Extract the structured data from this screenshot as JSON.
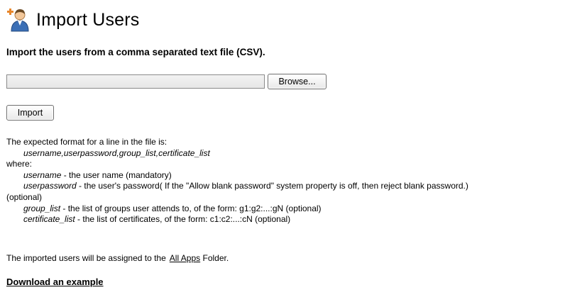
{
  "header": {
    "title": "Import Users",
    "icon": "add-user-icon",
    "subtitle": "Import the users from a comma separated text file (CSV)."
  },
  "file_picker": {
    "value": "",
    "browse_label": "Browse..."
  },
  "import_label": "Import",
  "format_help": {
    "intro": "The expected format for a line in the file is:",
    "format_line": "username,userpassword,group_list,certificate_list",
    "where": "where:",
    "fields": [
      {
        "name": "username",
        "desc": " - the user name (mandatory)"
      },
      {
        "name": "userpassword",
        "desc": " - the user's password( If the \"Allow blank password\" system property is off, then reject blank password.)"
      },
      {
        "name": "group_list",
        "desc": " - the list of groups user attends to, of the form: g1:g2:...:gN (optional)"
      },
      {
        "name": "certificate_list",
        "desc": " - the list of certificates, of the form: c1:c2:...:cN (optional)"
      }
    ],
    "optional_wrap": "(optional)"
  },
  "assignment": {
    "prefix": "The imported users will be assigned to the",
    "folder_link": "All Apps",
    "suffix": " Folder."
  },
  "download_label": "Download an example",
  "colors": {
    "icon_blue": "#3b6fb6",
    "icon_skin": "#f2c79a",
    "plus_orange": "#e8862a"
  }
}
